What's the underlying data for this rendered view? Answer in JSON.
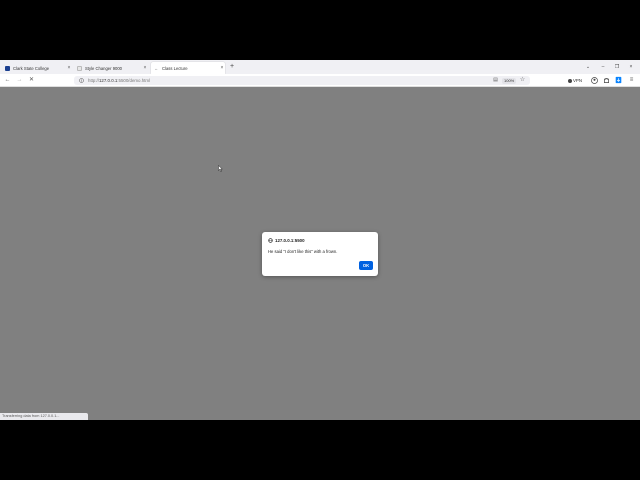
{
  "tabs": [
    {
      "label": "Clark State College",
      "favicon_color": "#1b3f8f",
      "active": false
    },
    {
      "label": "Style Changer 9000",
      "favicon_color": "#e8e8e8",
      "active": false
    },
    {
      "label": "Class Lecture",
      "favicon_color": "#ffffff",
      "active": true
    }
  ],
  "tab_close_glyph": "×",
  "new_tab_glyph": "+",
  "window_controls": {
    "minimize": "–",
    "restore": "❐",
    "close": "×",
    "list_all": "⌄"
  },
  "navigation": {
    "back": "←",
    "forward": "→",
    "stop": "✕"
  },
  "address_bar": {
    "url_prefix": "http://",
    "url_host": "127.0.0.1",
    "url_rest": ":5500/demo.html",
    "zoom": "100%"
  },
  "toolbar": {
    "vpn_label": "VPN"
  },
  "dialog": {
    "origin": "127.0.0.1:5500",
    "message": "He said \"I don't like this\" with a frown.",
    "ok_label": "OK"
  },
  "status_text": "Transferring data from 127.0.0.1...",
  "colors": {
    "page_background": "#808080",
    "ok_button": "#0061e0"
  }
}
